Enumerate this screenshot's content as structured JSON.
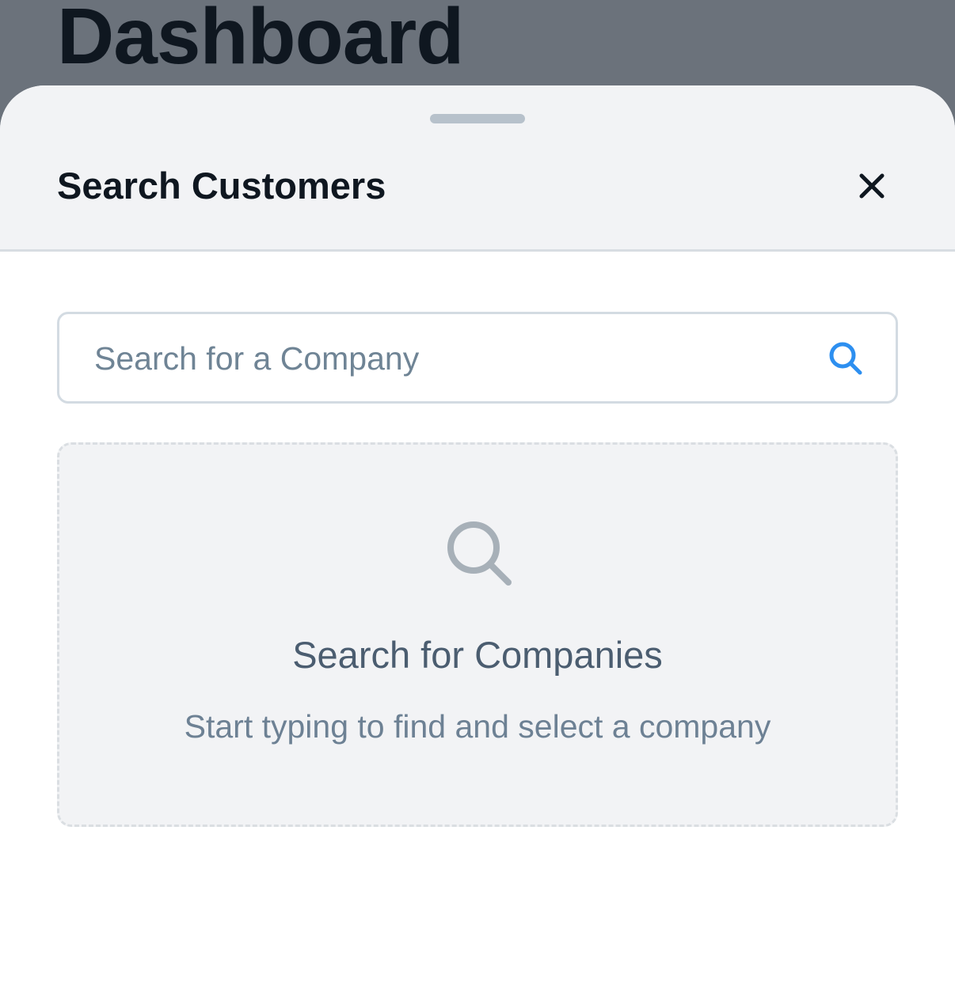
{
  "background": {
    "title": "Dashboard"
  },
  "sheet": {
    "title": "Search Customers",
    "close_icon": "close-icon"
  },
  "search": {
    "placeholder": "Search for a Company",
    "value": "",
    "icon": "search-icon",
    "icon_color": "#2d8ff0"
  },
  "empty_state": {
    "icon": "search-icon",
    "title": "Search for Companies",
    "subtitle": "Start typing to find and select a company"
  }
}
